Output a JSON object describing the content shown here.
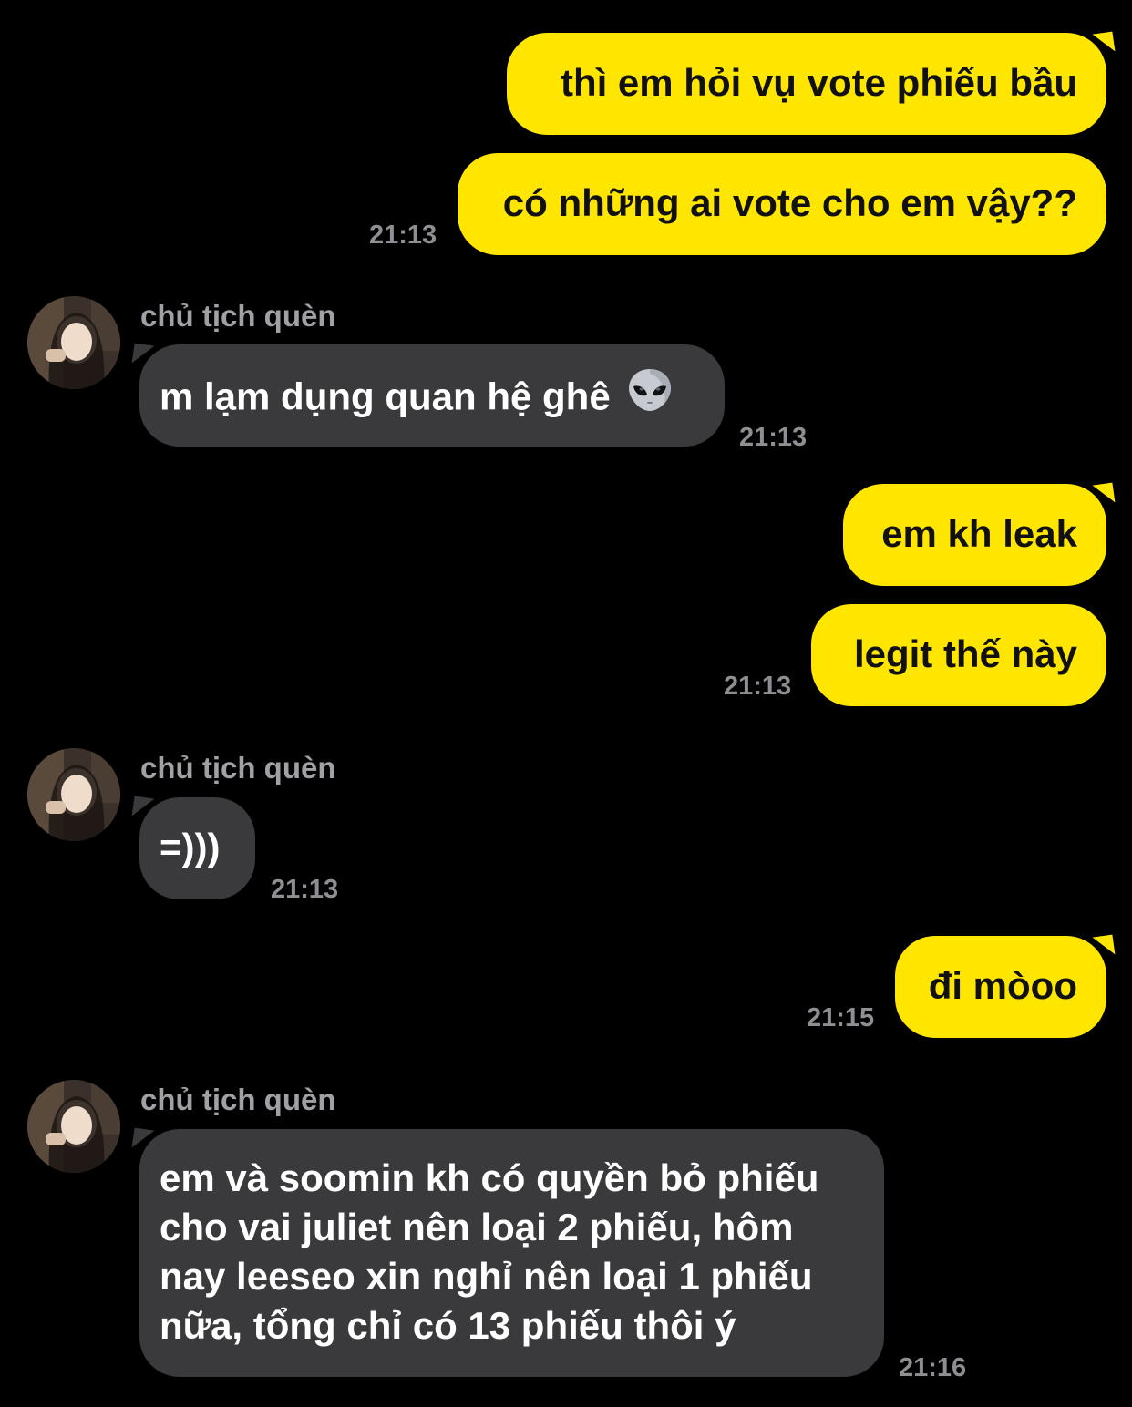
{
  "contact": {
    "name": "chủ tịch quèn"
  },
  "messages": {
    "m1": {
      "text": "thì em hỏi vụ vote phiếu bầu"
    },
    "m2": {
      "text": "có những ai vote cho em vậy??",
      "time": "21:13"
    },
    "m3": {
      "text": "m lạm dụng quan hệ ghê",
      "emoji": "alien-icon",
      "time": "21:13"
    },
    "m4": {
      "text": "em kh leak"
    },
    "m5": {
      "text": "legit thế này",
      "time": "21:13"
    },
    "m6": {
      "text": "=)))",
      "time": "21:13"
    },
    "m7": {
      "text": "đi mòoo",
      "time": "21:15"
    },
    "m8": {
      "lines": [
        "em và soomin kh có quyền bỏ phiếu",
        "cho vai juliet nên loại 2 phiếu, hôm",
        "nay leeseo xin nghỉ nên loại 1 phiếu",
        "nữa, tổng chỉ có 13 phiếu thôi ý"
      ],
      "time": "21:16"
    }
  },
  "colors": {
    "background": "#000000",
    "outgoing_bubble": "#ffe600",
    "incoming_bubble": "#3a3a3c",
    "timestamp": "#8e8e93"
  }
}
